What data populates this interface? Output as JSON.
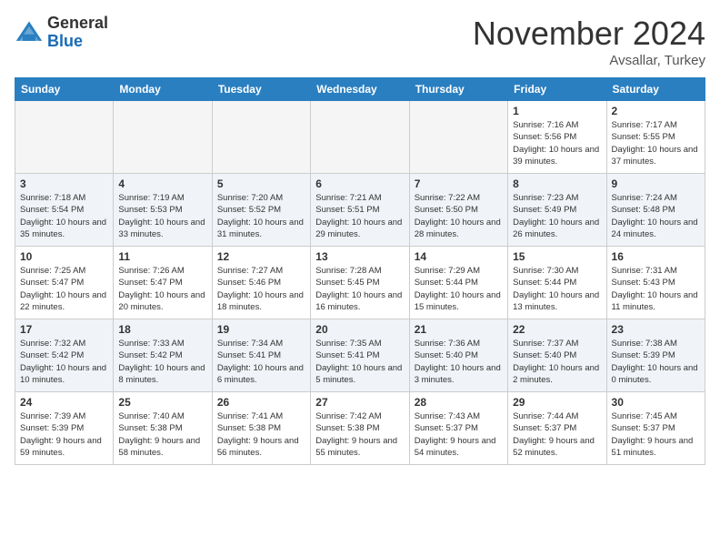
{
  "header": {
    "logo_general": "General",
    "logo_blue": "Blue",
    "month_title": "November 2024",
    "location": "Avsallar, Turkey"
  },
  "weekdays": [
    "Sunday",
    "Monday",
    "Tuesday",
    "Wednesday",
    "Thursday",
    "Friday",
    "Saturday"
  ],
  "weeks": [
    [
      {
        "day": "",
        "info": ""
      },
      {
        "day": "",
        "info": ""
      },
      {
        "day": "",
        "info": ""
      },
      {
        "day": "",
        "info": ""
      },
      {
        "day": "",
        "info": ""
      },
      {
        "day": "1",
        "info": "Sunrise: 7:16 AM\nSunset: 5:56 PM\nDaylight: 10 hours and 39 minutes."
      },
      {
        "day": "2",
        "info": "Sunrise: 7:17 AM\nSunset: 5:55 PM\nDaylight: 10 hours and 37 minutes."
      }
    ],
    [
      {
        "day": "3",
        "info": "Sunrise: 7:18 AM\nSunset: 5:54 PM\nDaylight: 10 hours and 35 minutes."
      },
      {
        "day": "4",
        "info": "Sunrise: 7:19 AM\nSunset: 5:53 PM\nDaylight: 10 hours and 33 minutes."
      },
      {
        "day": "5",
        "info": "Sunrise: 7:20 AM\nSunset: 5:52 PM\nDaylight: 10 hours and 31 minutes."
      },
      {
        "day": "6",
        "info": "Sunrise: 7:21 AM\nSunset: 5:51 PM\nDaylight: 10 hours and 29 minutes."
      },
      {
        "day": "7",
        "info": "Sunrise: 7:22 AM\nSunset: 5:50 PM\nDaylight: 10 hours and 28 minutes."
      },
      {
        "day": "8",
        "info": "Sunrise: 7:23 AM\nSunset: 5:49 PM\nDaylight: 10 hours and 26 minutes."
      },
      {
        "day": "9",
        "info": "Sunrise: 7:24 AM\nSunset: 5:48 PM\nDaylight: 10 hours and 24 minutes."
      }
    ],
    [
      {
        "day": "10",
        "info": "Sunrise: 7:25 AM\nSunset: 5:47 PM\nDaylight: 10 hours and 22 minutes."
      },
      {
        "day": "11",
        "info": "Sunrise: 7:26 AM\nSunset: 5:47 PM\nDaylight: 10 hours and 20 minutes."
      },
      {
        "day": "12",
        "info": "Sunrise: 7:27 AM\nSunset: 5:46 PM\nDaylight: 10 hours and 18 minutes."
      },
      {
        "day": "13",
        "info": "Sunrise: 7:28 AM\nSunset: 5:45 PM\nDaylight: 10 hours and 16 minutes."
      },
      {
        "day": "14",
        "info": "Sunrise: 7:29 AM\nSunset: 5:44 PM\nDaylight: 10 hours and 15 minutes."
      },
      {
        "day": "15",
        "info": "Sunrise: 7:30 AM\nSunset: 5:44 PM\nDaylight: 10 hours and 13 minutes."
      },
      {
        "day": "16",
        "info": "Sunrise: 7:31 AM\nSunset: 5:43 PM\nDaylight: 10 hours and 11 minutes."
      }
    ],
    [
      {
        "day": "17",
        "info": "Sunrise: 7:32 AM\nSunset: 5:42 PM\nDaylight: 10 hours and 10 minutes."
      },
      {
        "day": "18",
        "info": "Sunrise: 7:33 AM\nSunset: 5:42 PM\nDaylight: 10 hours and 8 minutes."
      },
      {
        "day": "19",
        "info": "Sunrise: 7:34 AM\nSunset: 5:41 PM\nDaylight: 10 hours and 6 minutes."
      },
      {
        "day": "20",
        "info": "Sunrise: 7:35 AM\nSunset: 5:41 PM\nDaylight: 10 hours and 5 minutes."
      },
      {
        "day": "21",
        "info": "Sunrise: 7:36 AM\nSunset: 5:40 PM\nDaylight: 10 hours and 3 minutes."
      },
      {
        "day": "22",
        "info": "Sunrise: 7:37 AM\nSunset: 5:40 PM\nDaylight: 10 hours and 2 minutes."
      },
      {
        "day": "23",
        "info": "Sunrise: 7:38 AM\nSunset: 5:39 PM\nDaylight: 10 hours and 0 minutes."
      }
    ],
    [
      {
        "day": "24",
        "info": "Sunrise: 7:39 AM\nSunset: 5:39 PM\nDaylight: 9 hours and 59 minutes."
      },
      {
        "day": "25",
        "info": "Sunrise: 7:40 AM\nSunset: 5:38 PM\nDaylight: 9 hours and 58 minutes."
      },
      {
        "day": "26",
        "info": "Sunrise: 7:41 AM\nSunset: 5:38 PM\nDaylight: 9 hours and 56 minutes."
      },
      {
        "day": "27",
        "info": "Sunrise: 7:42 AM\nSunset: 5:38 PM\nDaylight: 9 hours and 55 minutes."
      },
      {
        "day": "28",
        "info": "Sunrise: 7:43 AM\nSunset: 5:37 PM\nDaylight: 9 hours and 54 minutes."
      },
      {
        "day": "29",
        "info": "Sunrise: 7:44 AM\nSunset: 5:37 PM\nDaylight: 9 hours and 52 minutes."
      },
      {
        "day": "30",
        "info": "Sunrise: 7:45 AM\nSunset: 5:37 PM\nDaylight: 9 hours and 51 minutes."
      }
    ]
  ]
}
